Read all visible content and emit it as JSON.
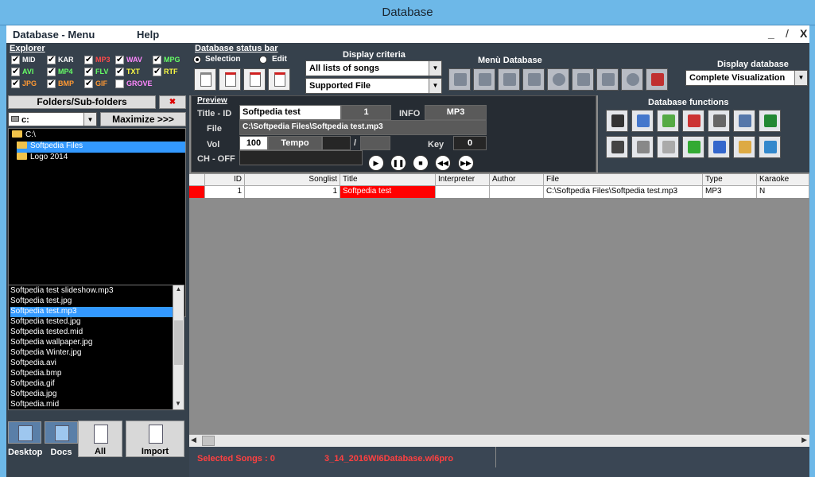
{
  "window": {
    "title": "Database"
  },
  "menu": {
    "items": [
      "Database - Menu",
      "Help"
    ],
    "minimize": "_",
    "restore": "/",
    "close": "X"
  },
  "explorer": {
    "title": "Explorer",
    "filters": [
      {
        "label": "MID",
        "checked": true,
        "color": "#ffffff"
      },
      {
        "label": "KAR",
        "checked": true,
        "color": "#ffffff"
      },
      {
        "label": "MP3",
        "checked": true,
        "color": "#ff4a4a"
      },
      {
        "label": "WAV",
        "checked": true,
        "color": "#ff88ff"
      },
      {
        "label": "MPG",
        "checked": true,
        "color": "#66ff66"
      },
      {
        "label": "AVI",
        "checked": true,
        "color": "#66ff66"
      },
      {
        "label": "MP4",
        "checked": true,
        "color": "#66ff66"
      },
      {
        "label": "FLV",
        "checked": true,
        "color": "#66ff66"
      },
      {
        "label": "TXT",
        "checked": true,
        "color": "#ffff44"
      },
      {
        "label": "RTF",
        "checked": true,
        "color": "#ffff44"
      },
      {
        "label": "JPG",
        "checked": true,
        "color": "#ff9933"
      },
      {
        "label": "BMP",
        "checked": true,
        "color": "#ff9933"
      },
      {
        "label": "GIF",
        "checked": true,
        "color": "#ff9933"
      },
      {
        "label": "GROVE",
        "checked": false,
        "color": "#ff88ff"
      }
    ],
    "folders_button": "Folders/Sub-folders",
    "clear_button": "✖",
    "drive": "c:",
    "maximize_button": "Maximize >>>",
    "tree": [
      {
        "label": "C:\\",
        "indent": 0,
        "selected": false
      },
      {
        "label": "Softpedia Files",
        "indent": 1,
        "selected": true
      },
      {
        "label": "Logo 2014",
        "indent": 1,
        "selected": false
      }
    ],
    "files": [
      "Softpedia test slideshow.mp3",
      "Softpedia test.jpg",
      "Softpedia test.mp3",
      "Softpedia tested.jpg",
      "Softpedia tested.mid",
      "Softpedia wallpaper.jpg",
      "Softpedia Winter.jpg",
      "Softpedia.avi",
      "Softpedia.bmp",
      "Softpedia.gif",
      "Softpedia.jpg",
      "Softpedia.mid"
    ],
    "selected_file_index": 2,
    "tiles": [
      {
        "label": "Desktop",
        "icon": "desktop-icon"
      },
      {
        "label": "Docs",
        "icon": "docs-icon"
      },
      {
        "label": "All",
        "icon": "all-icon"
      },
      {
        "label": "Import",
        "icon": "import-icon"
      }
    ]
  },
  "status_bar": {
    "title": "Database status bar",
    "radio_selection": "Selection",
    "radio_edit": "Edit"
  },
  "display_criteria": {
    "title": "Display criteria",
    "list": "All lists of songs",
    "filter": "Supported File"
  },
  "menu_database": {
    "title": "Menù Database"
  },
  "display_database": {
    "title": "Display database",
    "value": "Complete Visualization"
  },
  "preview": {
    "title": "Preview",
    "title_id_label": "Title - ID",
    "title_value": "Softpedia test",
    "id_value": "1",
    "info_label": "INFO",
    "info_value": "MP3",
    "file_label": "File",
    "file_value": "C:\\Softpedia Files\\Softpedia test.mp3",
    "vol_label": "Vol",
    "vol_value": "100",
    "tempo_label": "Tempo",
    "slash": "/",
    "key_label": "Key",
    "key_value": "0",
    "ch_label": "CH - OFF"
  },
  "database_functions": {
    "title": "Database functions"
  },
  "table": {
    "columns": [
      "",
      "ID",
      "Songlist",
      "Title",
      "Interpreter",
      "Author",
      "File",
      "Type",
      "Karaoke"
    ],
    "rows": [
      {
        "marker": "",
        "id": "1",
        "songlist": "1",
        "title": "Softpedia test",
        "interpreter": "",
        "author": "",
        "file": "C:\\Softpedia Files\\Softpedia test.mp3",
        "type": "MP3",
        "karaoke": "N"
      }
    ]
  },
  "status": {
    "selected_songs": "Selected Songs : 0",
    "db_file": "3_14_2016WI6Database.wl6pro"
  },
  "colors": {
    "accent_red": "#ff0000",
    "selection_blue": "#3399ff",
    "frame": "#6db8e8"
  }
}
